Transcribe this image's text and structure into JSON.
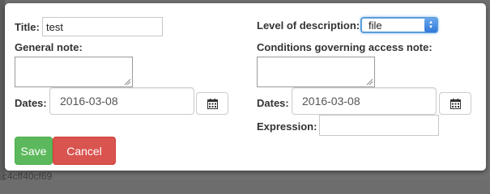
{
  "background": {
    "partial_text": "c4cff40cf69"
  },
  "form": {
    "title_label": "Title:",
    "title_value": "test",
    "general_note_label": "General note:",
    "dates_label_left": "Dates:",
    "dates_value_left": "2016-03-08",
    "level_label": "Level of description:",
    "level_value": "file",
    "conditions_label": "Conditions governing access note:",
    "dates_label_right": "Dates:",
    "dates_value_right": "2016-03-08",
    "expression_label": "Expression:",
    "expression_value": ""
  },
  "buttons": {
    "save_label": "Save",
    "cancel_label": "Cancel"
  },
  "colors": {
    "save": "#5cb85c",
    "cancel": "#d9534f",
    "select_focus": "#5b9dd9"
  },
  "icons": {
    "calendar": "calendar-icon",
    "resize": "resize-grip-icon",
    "select": "select-arrows-icon"
  }
}
